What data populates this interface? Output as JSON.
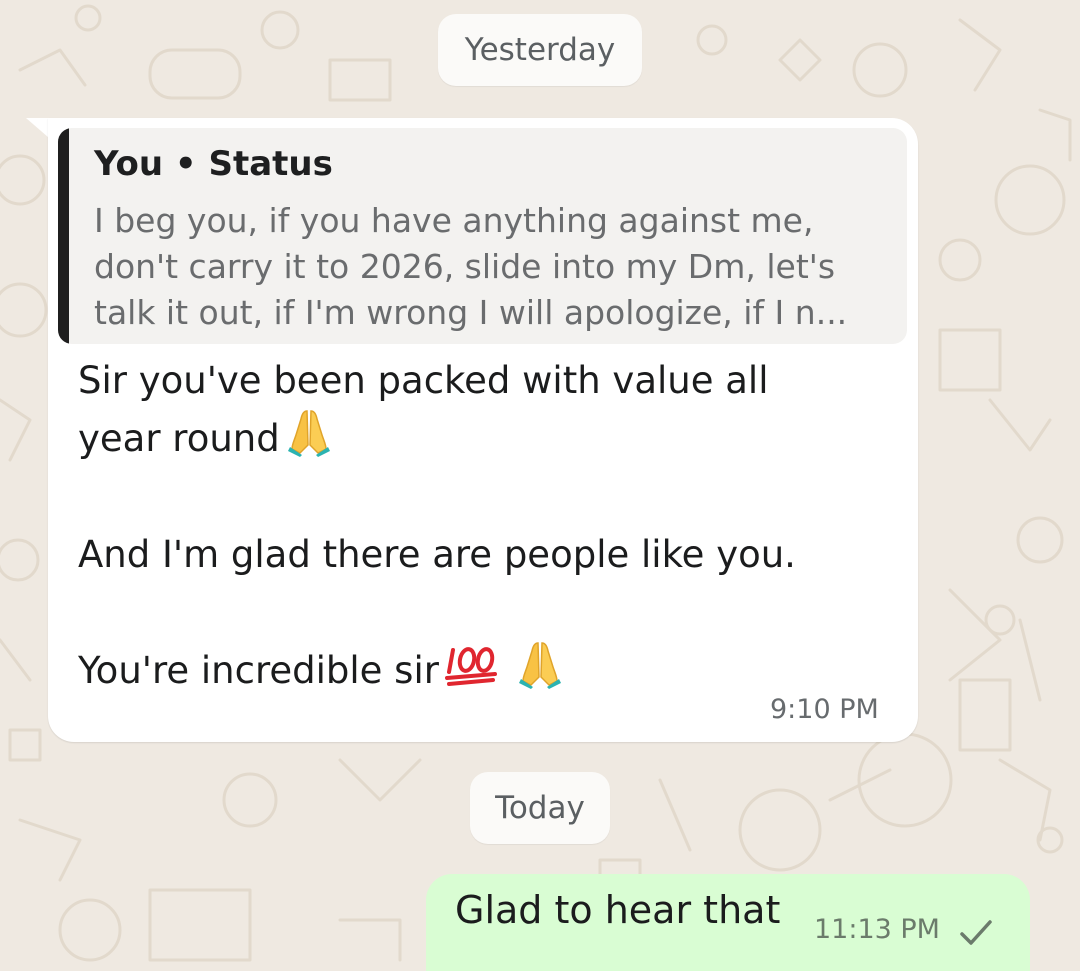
{
  "chat": {
    "date_separators": {
      "yesterday": "Yesterday",
      "today": "Today"
    },
    "incoming_message": {
      "quote": {
        "author": "You • Status",
        "lines": [
          "I beg you, if you have anything against me,",
          "don't carry it to 2026, slide into my Dm, let's",
          "talk it out, if I'm wrong I will apologize, if I n..."
        ]
      },
      "lines": [
        "Sir you've been packed with value all",
        "year round",
        "And I'm glad there are people like you.",
        "You're incredible sir"
      ],
      "emojis": [
        "folded-hands",
        "hundred-points",
        "folded-hands"
      ],
      "time": "9:10 PM"
    },
    "outgoing_message": {
      "text": "Glad to hear that",
      "time": "11:13 PM",
      "status_icon": "single-check-icon"
    }
  },
  "colors": {
    "chat_background": "#efe9e1",
    "incoming_bubble": "#ffffff",
    "outgoing_bubble": "#d9fdd3",
    "quote_bar": "#1f1f1f",
    "date_chip": "#fbfaf8"
  }
}
